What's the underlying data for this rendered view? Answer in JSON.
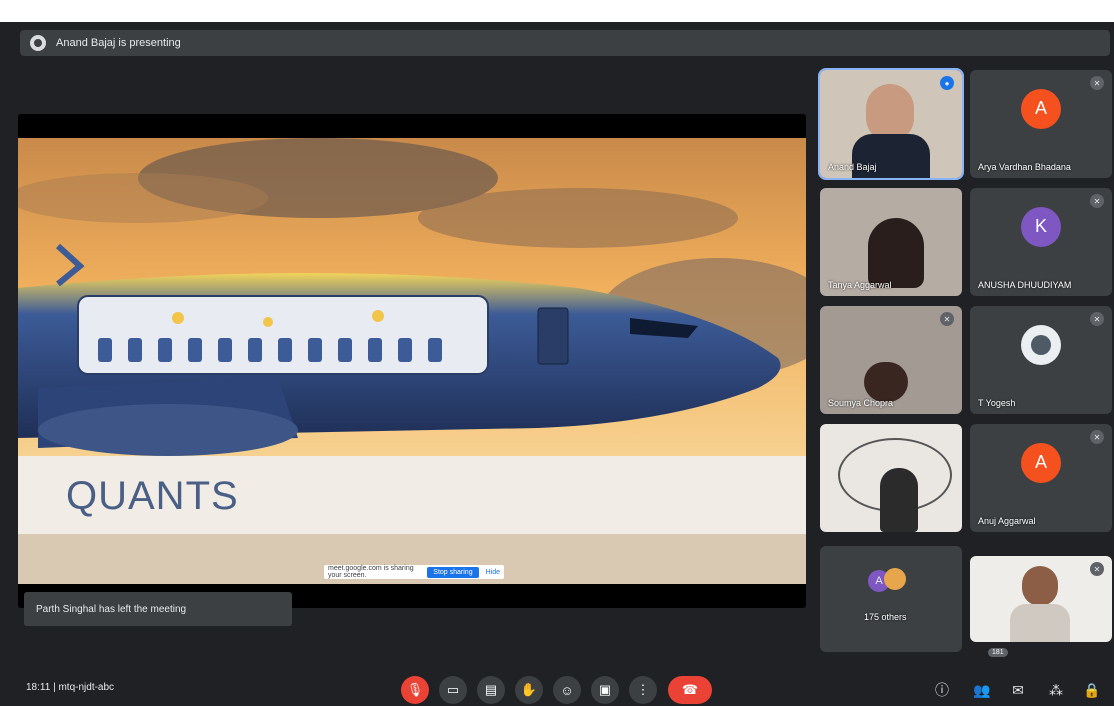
{
  "banner": {
    "presenter_text": "Anand Bajaj is presenting"
  },
  "slide": {
    "title": "QUANTS"
  },
  "share_bar": {
    "message": "meet.google.com is sharing your screen.",
    "stop_label": "Stop sharing",
    "hide_label": "Hide"
  },
  "toast": {
    "text": "Parth Singhal has left the meeting"
  },
  "participants": [
    {
      "name": "Anand Bajaj"
    },
    {
      "name": "Arya Vardhan Bhadana"
    },
    {
      "name": "Tanya Aggarwal"
    },
    {
      "name": "ANUSHA DHUUDIYAM"
    },
    {
      "name": "Soumya Chopra"
    },
    {
      "name": "T Yogesh"
    },
    {
      "name": ""
    },
    {
      "name": "Anuj Aggarwal"
    },
    {
      "name": "175 others"
    },
    {
      "name": ""
    }
  ],
  "avatars": {
    "a1": "A",
    "k": "K",
    "a2": "A",
    "a3": "A"
  },
  "meeting": {
    "time": "18:11",
    "code": "mtq-njdt-abc"
  },
  "participant_count": "181",
  "colors": {
    "end_call": "#ea4335",
    "accent": "#1a73e8",
    "tile": "#3c4043"
  },
  "icons": [
    "mic-off-icon",
    "camera-icon",
    "captions-icon",
    "raise-hand-icon",
    "emoji-icon",
    "present-icon",
    "more-icon",
    "end-call-icon",
    "info-icon",
    "people-icon",
    "chat-icon",
    "activities-icon",
    "lock-icon"
  ]
}
